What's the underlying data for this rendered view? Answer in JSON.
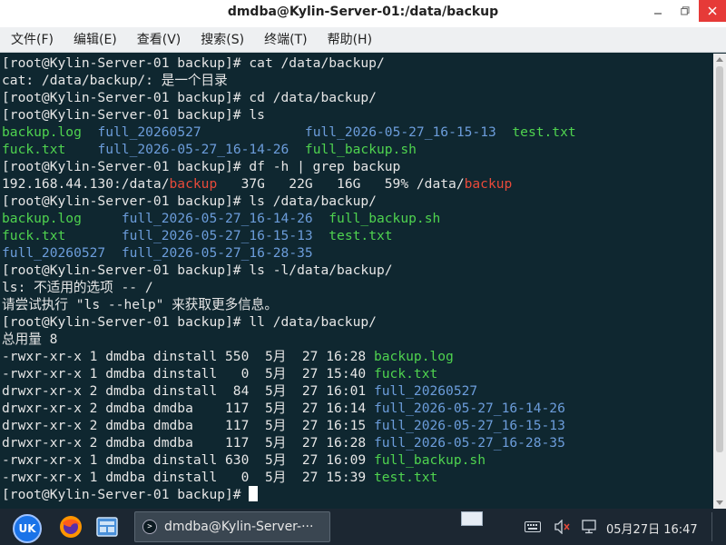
{
  "window": {
    "title": "dmdba@Kylin-Server-01:/data/backup"
  },
  "menubar": {
    "items": [
      "文件(F)",
      "编辑(E)",
      "查看(V)",
      "搜索(S)",
      "终端(T)",
      "帮助(H)"
    ]
  },
  "terminal": {
    "lines": [
      [
        {
          "t": "[root@Kylin-Server-01 backup]# cat /data/backup/"
        }
      ],
      [
        {
          "t": "cat: /data/backup/: 是一个目录"
        }
      ],
      [
        {
          "t": "[root@Kylin-Server-01 backup]# cd /data/backup/"
        }
      ],
      [
        {
          "t": "[root@Kylin-Server-01 backup]# ls"
        }
      ],
      [
        {
          "t": "backup.log",
          "c": "green"
        },
        {
          "t": "  "
        },
        {
          "t": "full_20260527",
          "c": "blue"
        },
        {
          "t": "             "
        },
        {
          "t": "full_2026-05-27_16-15-13",
          "c": "blue"
        },
        {
          "t": "  "
        },
        {
          "t": "test.txt",
          "c": "green"
        }
      ],
      [
        {
          "t": "fuck.txt",
          "c": "green"
        },
        {
          "t": "    "
        },
        {
          "t": "full_2026-05-27_16-14-26",
          "c": "blue"
        },
        {
          "t": "  "
        },
        {
          "t": "full_backup.sh",
          "c": "green"
        }
      ],
      [
        {
          "t": "[root@Kylin-Server-01 backup]# df -h | grep backup"
        }
      ],
      [
        {
          "t": "192.168.44.130:/data/"
        },
        {
          "t": "backup",
          "c": "red"
        },
        {
          "t": "   37G   22G   16G   59% /data/"
        },
        {
          "t": "backup",
          "c": "red"
        }
      ],
      [
        {
          "t": "[root@Kylin-Server-01 backup]# ls /data/backup/"
        }
      ],
      [
        {
          "t": "backup.log",
          "c": "green"
        },
        {
          "t": "     "
        },
        {
          "t": "full_2026-05-27_16-14-26",
          "c": "blue"
        },
        {
          "t": "  "
        },
        {
          "t": "full_backup.sh",
          "c": "green"
        }
      ],
      [
        {
          "t": "fuck.txt",
          "c": "green"
        },
        {
          "t": "       "
        },
        {
          "t": "full_2026-05-27_16-15-13",
          "c": "blue"
        },
        {
          "t": "  "
        },
        {
          "t": "test.txt",
          "c": "green"
        }
      ],
      [
        {
          "t": "full_20260527",
          "c": "blue"
        },
        {
          "t": "  "
        },
        {
          "t": "full_2026-05-27_16-28-35",
          "c": "blue"
        }
      ],
      [
        {
          "t": "[root@Kylin-Server-01 backup]# ls -l/data/backup/"
        }
      ],
      [
        {
          "t": "ls: 不适用的选项 -- /"
        }
      ],
      [
        {
          "t": "请尝试执行 \"ls --help\" 来获取更多信息。"
        }
      ],
      [
        {
          "t": "[root@Kylin-Server-01 backup]# ll /data/backup/"
        }
      ],
      [
        {
          "t": "总用量 8"
        }
      ],
      [
        {
          "t": "-rwxr-xr-x 1 dmdba dinstall 550  5月  27 16:28 "
        },
        {
          "t": "backup.log",
          "c": "green"
        }
      ],
      [
        {
          "t": "-rwxr-xr-x 1 dmdba dinstall   0  5月  27 15:40 "
        },
        {
          "t": "fuck.txt",
          "c": "green"
        }
      ],
      [
        {
          "t": "drwxr-xr-x 2 dmdba dinstall  84  5月  27 16:01 "
        },
        {
          "t": "full_20260527",
          "c": "blue"
        }
      ],
      [
        {
          "t": "drwxr-xr-x 2 dmdba dmdba    117  5月  27 16:14 "
        },
        {
          "t": "full_2026-05-27_16-14-26",
          "c": "blue"
        }
      ],
      [
        {
          "t": "drwxr-xr-x 2 dmdba dmdba    117  5月  27 16:15 "
        },
        {
          "t": "full_2026-05-27_16-15-13",
          "c": "blue"
        }
      ],
      [
        {
          "t": "drwxr-xr-x 2 dmdba dmdba    117  5月  27 16:28 "
        },
        {
          "t": "full_2026-05-27_16-28-35",
          "c": "blue"
        }
      ],
      [
        {
          "t": "-rwxr-xr-x 1 dmdba dinstall 630  5月  27 16:09 "
        },
        {
          "t": "full_backup.sh",
          "c": "green"
        }
      ],
      [
        {
          "t": "-rwxr-xr-x 1 dmdba dinstall   0  5月  27 15:39 "
        },
        {
          "t": "test.txt",
          "c": "green"
        }
      ],
      [
        {
          "t": "[root@Kylin-Server-01 backup]# "
        },
        {
          "cursor": true
        }
      ]
    ]
  },
  "taskbar": {
    "start_label": "UK",
    "task_title": "dmdba@Kylin-Server-···",
    "clock": "05月27日 16:47"
  },
  "colors": {
    "terminal_bg": "#0f2730",
    "green": "#4fd34f",
    "blue": "#6c9ddb",
    "red": "#e84a3a",
    "close_button": "#e63a38",
    "taskbar_bg": "#1c2732"
  },
  "icons": {
    "minimize": "minimize-icon",
    "maximize": "maximize-icon",
    "close": "close-icon",
    "firefox": "firefox-icon",
    "file_manager": "file-manager-icon",
    "terminal": "terminal-icon",
    "keyboard": "keyboard-icon",
    "volume_muted": "volume-muted-icon",
    "network": "network-icon"
  }
}
